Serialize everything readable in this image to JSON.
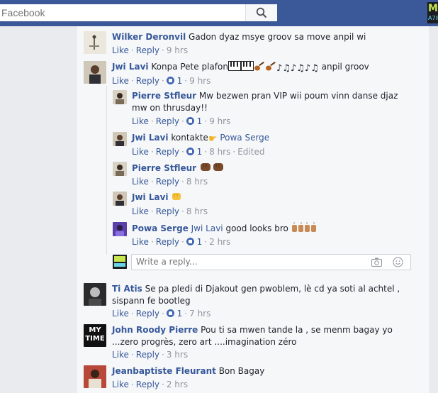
{
  "search": {
    "placeholder": "Facebook"
  },
  "corner_logo": {
    "line1": "M",
    "line2": "A7IN"
  },
  "action_labels": {
    "like": "Like",
    "reply": "Reply",
    "sep": "·",
    "edited": "Edited"
  },
  "reply_box": {
    "placeholder": "Write a reply..."
  },
  "comments": [
    {
      "author": "Wilker Deronvil",
      "text": "Gadon dyaz msye groov sa move anpil wi",
      "time": "9 hrs"
    },
    {
      "author": "Jwi Lavi",
      "text_before": "Konpa Pete plafon",
      "text_after": "anpil groov",
      "likes": "1",
      "time": "9 hrs"
    },
    {
      "author": "Pierre Stfleur",
      "text": "Mw bezwen pran VIP wii poum vinn danse djaz mw on thrusday!!",
      "likes": "1",
      "time": "9 hrs"
    },
    {
      "author": "Jwi Lavi",
      "text": "kontakte",
      "mention": "Powa Serge",
      "likes": "1",
      "time": "8 hrs"
    },
    {
      "author": "Pierre Stfleur",
      "text": "",
      "time": "8 hrs"
    },
    {
      "author": "Jwi Lavi",
      "text": "",
      "time": "8 hrs"
    },
    {
      "author": "Powa Serge",
      "mention": "Jwi Lavi",
      "text": "good looks bro",
      "likes": "1",
      "time": "2 hrs"
    },
    {
      "author": "Ti Atis",
      "text": "Se pa pledi di Djakout gen pwoblem, lè cd ya soti al achtel , sispann fe bootleg",
      "likes": "1",
      "time": "7 hrs"
    },
    {
      "author": "John Roody Pierre",
      "text": "Pou ti sa mwen tande la , se menm bagay yo ...zero progrès, zero art ....imagination zéro",
      "time": "3 hrs",
      "avatar_line1": "MY",
      "avatar_line2": "TIME"
    },
    {
      "author": "Jeanbaptiste Fleurant",
      "text": "Bon Bagay",
      "time": "2 hrs"
    }
  ]
}
